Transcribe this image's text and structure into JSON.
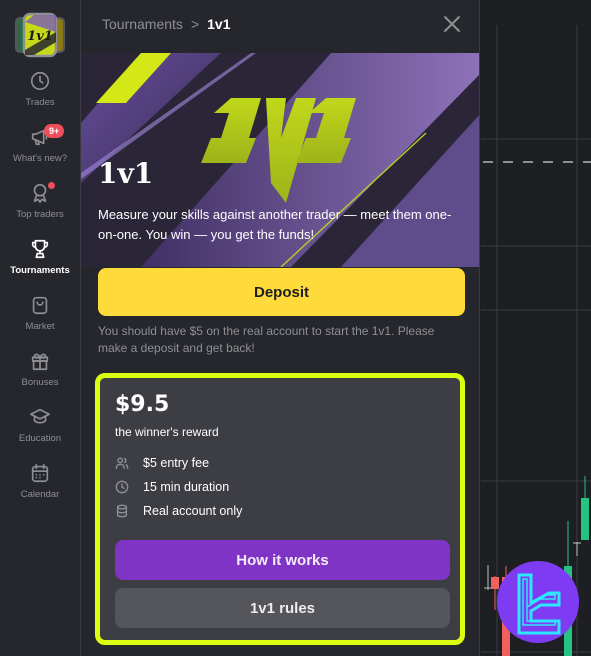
{
  "sidebar": {
    "items": [
      {
        "label": "Trades",
        "icon": "clock-icon",
        "active": false
      },
      {
        "label": "What's new?",
        "icon": "megaphone-icon",
        "badge": "9+",
        "active": false
      },
      {
        "label": "Top traders",
        "icon": "award-icon",
        "dot": true,
        "active": false
      },
      {
        "label": "Tournaments",
        "icon": "trophy-icon",
        "active": true
      },
      {
        "label": "Market",
        "icon": "shopping-bag-icon",
        "active": false
      },
      {
        "label": "Bonuses",
        "icon": "gift-icon",
        "active": false
      },
      {
        "label": "Education",
        "icon": "graduation-cap-icon",
        "active": false
      },
      {
        "label": "Calendar",
        "icon": "calendar-icon",
        "active": false
      }
    ]
  },
  "panel": {
    "breadcrumb": {
      "parent": "Tournaments",
      "separator": ">",
      "current": "1v1"
    },
    "hero": {
      "logo_text": "1V1",
      "title": "1v1",
      "description": "Measure your skills against another trader — meet them one-on-one. You win — you get the funds!"
    },
    "deposit_label": "Deposit",
    "note": "You should have $5 on the real account to start the 1v1. Please make a deposit and get back!",
    "card": {
      "reward": "$9.5",
      "reward_label": "the winner's reward",
      "features": [
        {
          "icon": "users-icon",
          "text": "$5 entry fee"
        },
        {
          "icon": "clock-icon",
          "text": "15 min duration"
        },
        {
          "icon": "database-icon",
          "text": "Real account only"
        }
      ],
      "how_label": "How it works",
      "rules_label": "1v1 rules"
    }
  },
  "colors": {
    "accent_yellow": "#fedb3b",
    "card_border": "#dcff0f",
    "purple": "#8034c5",
    "badge_red": "#ef4f5c",
    "candle_up": "#26c281",
    "candle_down": "#f0605d"
  }
}
